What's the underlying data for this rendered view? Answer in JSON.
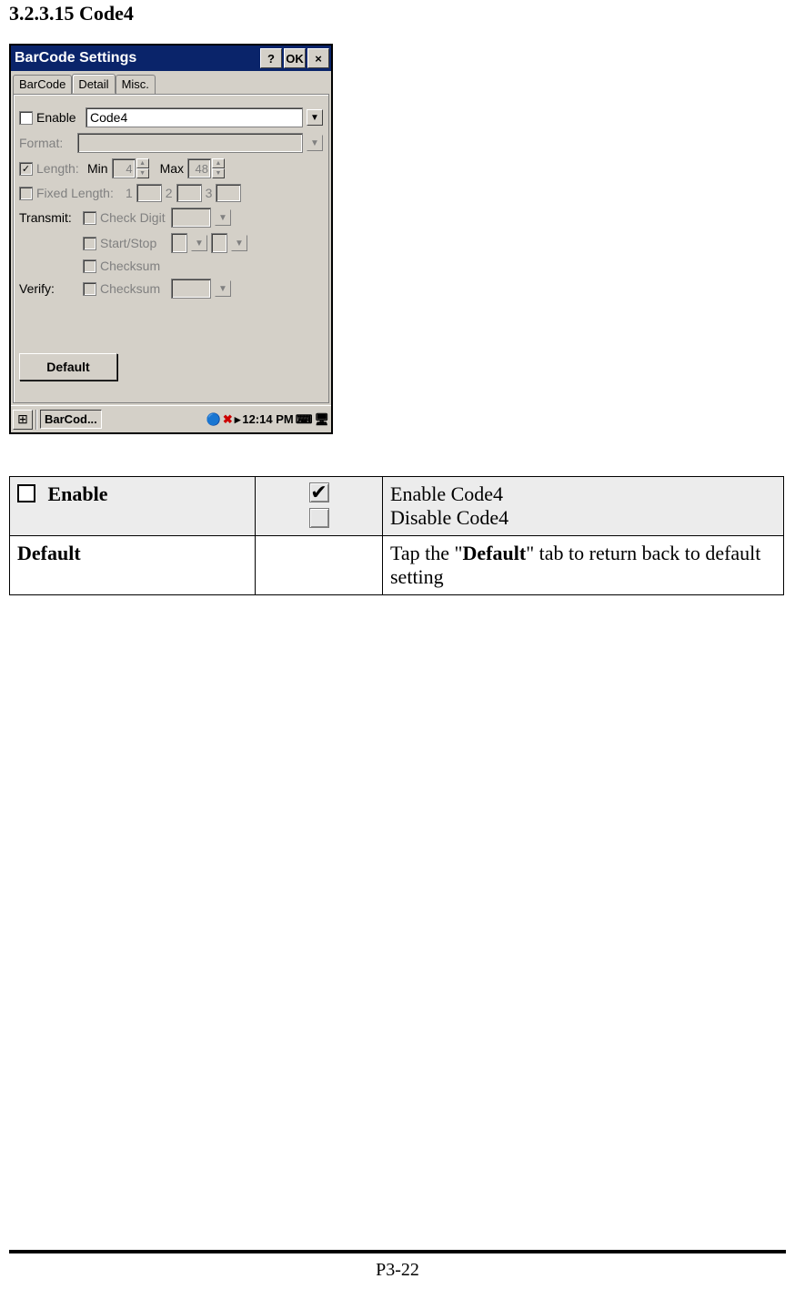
{
  "heading": "3.2.3.15 Code4",
  "window": {
    "title": "BarCode Settings",
    "btn_help": "?",
    "btn_ok": "OK",
    "btn_close": "×",
    "tabs": [
      "BarCode",
      "Detail",
      "Misc."
    ],
    "enable_label": "Enable",
    "code_select_value": "Code4",
    "format_label": "Format:",
    "length_label": "Length:",
    "min_label": "Min",
    "min_value": "4",
    "max_label": "Max",
    "max_value": "48",
    "fixed_length_label": "Fixed Length:",
    "fixed1": "1",
    "fixed2": "2",
    "fixed3": "3",
    "transmit_label": "Transmit:",
    "transmit_check_digit": "Check Digit",
    "transmit_start_stop": "Start/Stop",
    "transmit_checksum": "Checksum",
    "verify_label": "Verify:",
    "verify_checksum": "Checksum",
    "default_button": "Default",
    "taskbar_app": "BarCod...",
    "taskbar_time": "12:14 PM"
  },
  "table": {
    "row1_option": "Enable",
    "row1_desc_checked": "Enable Code4",
    "row1_desc_unchecked": "Disable Code4",
    "row2_option": "Default",
    "row2_desc_prefix": "Tap the \"",
    "row2_desc_bold": "Default",
    "row2_desc_suffix": "\" tab to return back to default setting"
  },
  "footer": {
    "page": "P3-22"
  }
}
